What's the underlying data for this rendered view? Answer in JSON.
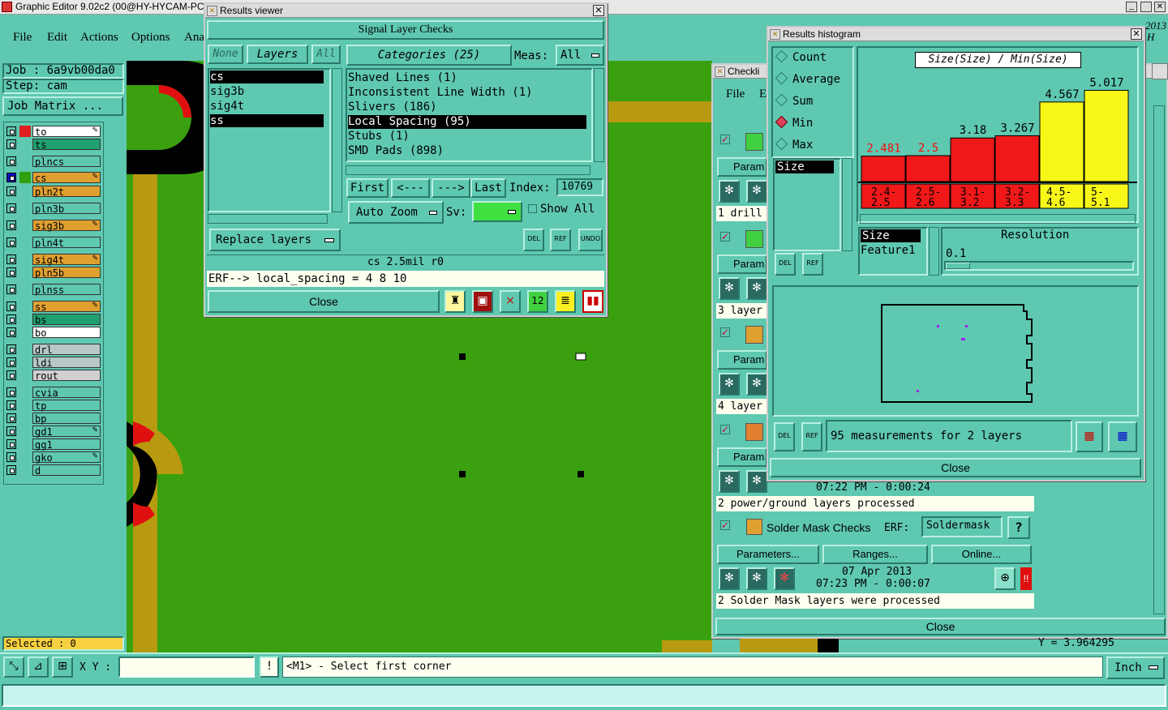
{
  "app": {
    "title": "Graphic Editor 9.02c2 (00@HY-HYCAM-PC",
    "menu": [
      "File",
      "Edit",
      "Actions",
      "Options",
      "Ana"
    ],
    "job_label": "Job : 6a9vb00da0",
    "step_label": "Step: cam",
    "job_matrix": "Job Matrix ...",
    "selected": "Selected : 0",
    "xy_label": "X Y :",
    "status_msg": "<M1> - Select first corner",
    "units": "Inch",
    "bg_title_fragment": "2013",
    "bg_title_fragment2": "H",
    "coord_readout": "Y = 3.964295"
  },
  "layers": [
    {
      "name": "to",
      "color": "#ffffff",
      "swatch": "#e02020",
      "star": true
    },
    {
      "name": "ts",
      "color": "#20a070",
      "swatch": "#5fc8b0",
      "star": false
    },
    {
      "name": "plncs",
      "color": "#5fc8b0",
      "swatch": "#5fc8b0",
      "star": false
    },
    {
      "name": "cs",
      "color": "#e0a030",
      "swatch": "#30a010",
      "star": true,
      "active": true
    },
    {
      "name": "pln2t",
      "color": "#e0a030",
      "swatch": "#5fc8b0",
      "star": false
    },
    {
      "name": "pln3b",
      "color": "#5fc8b0",
      "swatch": "#5fc8b0",
      "star": false
    },
    {
      "name": "sig3b",
      "color": "#e0a030",
      "swatch": "#5fc8b0",
      "star": true
    },
    {
      "name": "pln4t",
      "color": "#5fc8b0",
      "swatch": "#5fc8b0",
      "star": false
    },
    {
      "name": "sig4t",
      "color": "#e0a030",
      "swatch": "#5fc8b0",
      "star": true
    },
    {
      "name": "pln5b",
      "color": "#e0a030",
      "swatch": "#5fc8b0",
      "star": false
    },
    {
      "name": "plnss",
      "color": "#5fc8b0",
      "swatch": "#5fc8b0",
      "star": false
    },
    {
      "name": "ss",
      "color": "#e0a030",
      "swatch": "#5fc8b0",
      "star": true
    },
    {
      "name": "bs",
      "color": "#20a070",
      "swatch": "#5fc8b0",
      "star": false
    },
    {
      "name": "bo",
      "color": "#ffffff",
      "swatch": "#5fc8b0",
      "star": false
    },
    {
      "name": "drl",
      "color": "#b8c8c8",
      "swatch": "#5fc8b0",
      "star": false
    },
    {
      "name": "ldi",
      "color": "#b8c8c8",
      "swatch": "#5fc8b0",
      "star": false
    },
    {
      "name": "rout",
      "color": "#d0d0d0",
      "swatch": "#5fc8b0",
      "star": false
    },
    {
      "name": "cvia",
      "color": "#5fc8b0",
      "swatch": "#5fc8b0",
      "star": false
    },
    {
      "name": "tp",
      "color": "#5fc8b0",
      "swatch": "#5fc8b0",
      "star": false
    },
    {
      "name": "bp",
      "color": "#5fc8b0",
      "swatch": "#5fc8b0",
      "star": false
    },
    {
      "name": "gd1",
      "color": "#5fc8b0",
      "swatch": "#5fc8b0",
      "star": true
    },
    {
      "name": "gg1",
      "color": "#5fc8b0",
      "swatch": "#5fc8b0",
      "star": false
    },
    {
      "name": "gko",
      "color": "#5fc8b0",
      "swatch": "#5fc8b0",
      "star": true
    },
    {
      "name": "d",
      "color": "#5fc8b0",
      "swatch": "#5fc8b0",
      "star": false
    }
  ],
  "results_viewer": {
    "title": "Results viewer",
    "header": "Signal Layer Checks",
    "none_btn": "None",
    "layers_btn": "Layers",
    "all_btn": "All",
    "layer_list": [
      "cs",
      "sig3b",
      "sig4t",
      "ss"
    ],
    "categories_btn": "Categories (25)",
    "meas_label": "Meas:",
    "meas_value": "All",
    "categories": [
      "Shaved Lines (1)",
      "Inconsistent Line Width (1)",
      "Slivers (186)",
      "Local Spacing (95)",
      "Stubs (1)",
      "SMD Pads (898)"
    ],
    "selected_category": 3,
    "first": "First",
    "prev": "<---",
    "next": "--->",
    "last": "Last",
    "index_label": "Index:",
    "index_value": "10769",
    "auto_zoom": "Auto Zoom",
    "sv_label": "Sv:",
    "show_all": "Show All",
    "replace_layers": "Replace layers",
    "info_line": "cs 2.5mil  r0",
    "erf_line": "ERF--> local_spacing = 4 8 10",
    "close": "Close",
    "del": "DEL",
    "ref": "REF",
    "undo": "UNDO"
  },
  "histogram": {
    "title": "Results histogram",
    "modes": [
      "Count",
      "Average",
      "Sum",
      "Min",
      "Max"
    ],
    "selected_mode": "Min",
    "attr_list": [
      "Size"
    ],
    "chart_title": "Size(Size) / Min(Size)",
    "features": [
      "Size",
      "Feature1"
    ],
    "resolution_label": "Resolution",
    "resolution_value": "0.1",
    "measurements": "95 measurements for 2 layers",
    "close": "Close",
    "del": "DEL",
    "ref": "REF"
  },
  "chart_data": {
    "type": "bar",
    "title": "Size(Size) / Min(Size)",
    "categories": [
      "2.4-2.5",
      "2.5-2.6",
      "3.1-3.2",
      "3.2-3.3",
      "4.5-4.6",
      "5-5.1"
    ],
    "category_lines": [
      [
        "2.4-",
        "2.5"
      ],
      [
        "2.5-",
        "2.6"
      ],
      [
        "3.1-",
        "3.2"
      ],
      [
        "3.2-",
        "3.3"
      ],
      [
        "4.5-",
        "4.6"
      ],
      [
        "5-",
        "5.1"
      ]
    ],
    "values": [
      2.481,
      2.5,
      3.18,
      3.267,
      4.567,
      5.017
    ],
    "value_labels": [
      "2.481",
      "2.5",
      "3.18",
      "3.267",
      "4.567",
      "5.017"
    ],
    "bar_colors": [
      "#f01818",
      "#f01818",
      "#f01818",
      "#f01818",
      "#f8f818",
      "#f8f818"
    ],
    "ylim": [
      1.5,
      5.5
    ]
  },
  "checklist": {
    "title": "Checkli",
    "menu": [
      "File",
      "E"
    ],
    "param_label": "Param",
    "rows_text": [
      "1 drill",
      "3 layer",
      "4 layer"
    ],
    "pg_time": "07:22 PM - 0:00:24",
    "pg_status": "2 power/ground layers processed",
    "sm_name": "Solder Mask Checks",
    "erf_label": "ERF:",
    "erf_value": "Soldermask",
    "parameters": "Parameters...",
    "ranges": "Ranges...",
    "online": "Online...",
    "sm_date": "07 Apr 2013",
    "sm_time": "07:23 PM - 0:00:07",
    "sm_status": "2 Solder Mask layers were processed",
    "close": "Close",
    "help": "?"
  }
}
